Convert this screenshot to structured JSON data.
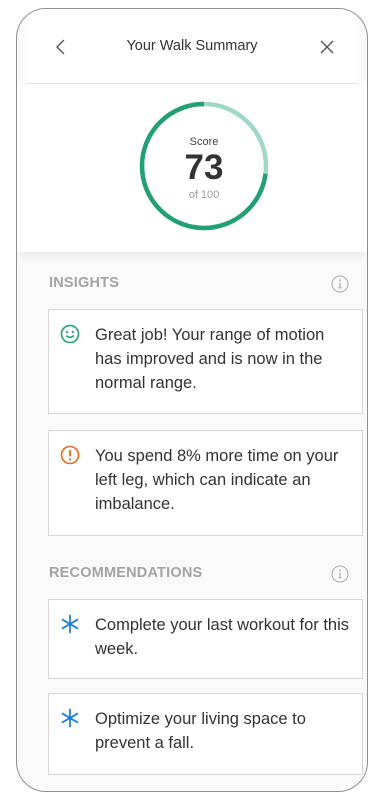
{
  "header": {
    "title": "Your Walk Summary",
    "back_icon": "chevron-left-icon",
    "close_icon": "close-icon"
  },
  "score": {
    "label": "Score",
    "value": "73",
    "max_label": "of 100",
    "fraction": 0.73,
    "ring_color": "#23a072",
    "track_color": "#9fd9c3"
  },
  "insights": {
    "title": "INSIGHTS",
    "info_icon": "info-icon",
    "items": [
      {
        "icon": "smile-icon",
        "icon_color": "#23a072",
        "text": "Great job! Your range of motion has improved and is now in the normal range."
      },
      {
        "icon": "alert-circle-icon",
        "icon_color": "#ef6a1f",
        "text": "You spend 8% more time on your left leg, which can indicate an imbalance."
      }
    ]
  },
  "recommendations": {
    "title": "RECOMMENDATIONS",
    "info_icon": "info-icon",
    "items": [
      {
        "icon": "asterisk-icon",
        "icon_color": "#1f7fd6",
        "text": "Complete your last workout for this week."
      },
      {
        "icon": "asterisk-icon",
        "icon_color": "#1f7fd6",
        "text": "Optimize your living space to prevent a fall."
      }
    ]
  }
}
